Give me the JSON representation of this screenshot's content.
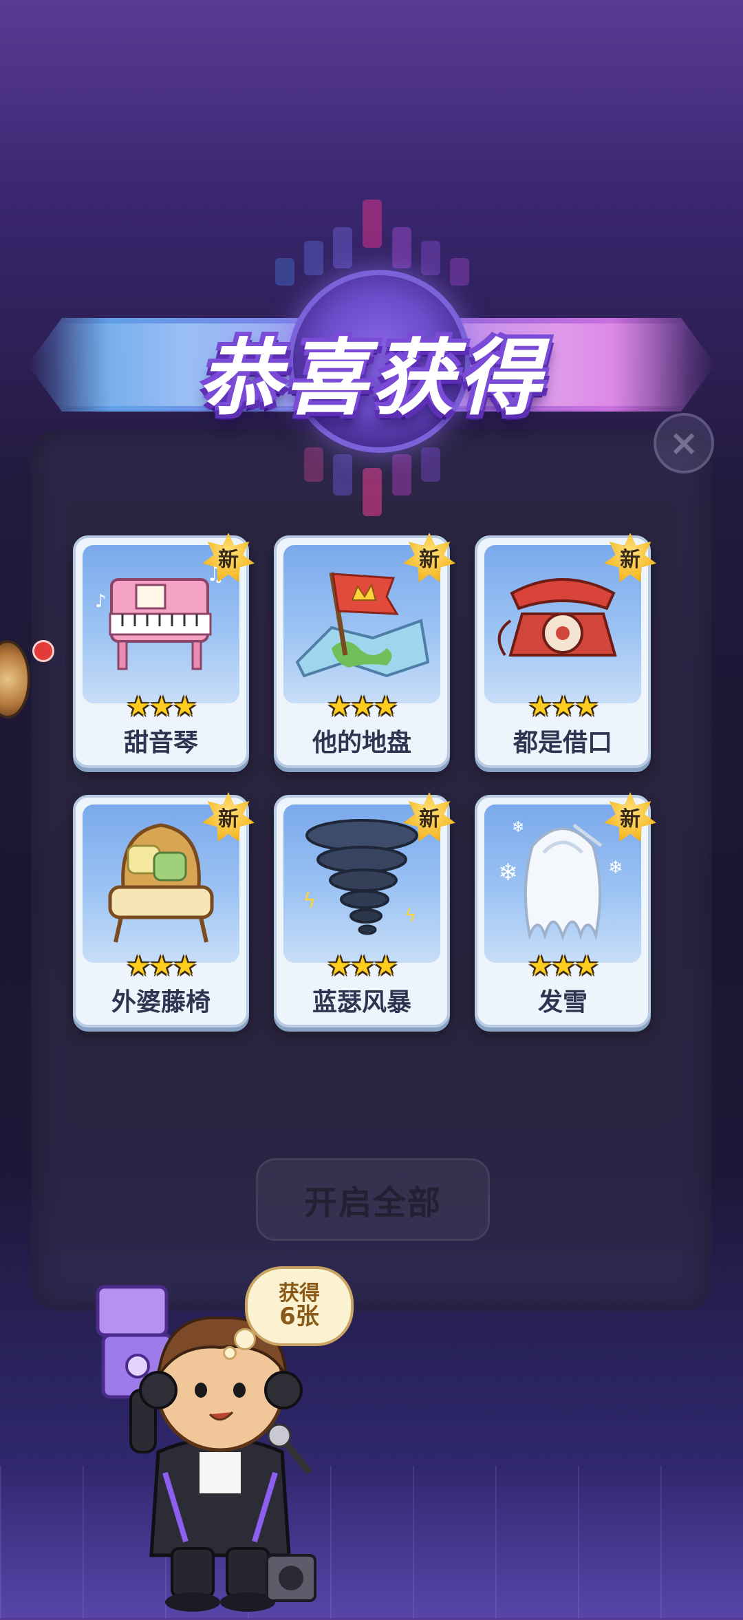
{
  "title": "恭喜获得",
  "rewards": [
    {
      "name": "甜音琴",
      "stars": "★★★",
      "badge": "新",
      "icon": "pink-piano"
    },
    {
      "name": "他的地盘",
      "stars": "★★★",
      "badge": "新",
      "icon": "crown-flag-map"
    },
    {
      "name": "都是借口",
      "stars": "★★★",
      "badge": "新",
      "icon": "red-rotary-telephone"
    },
    {
      "name": "外婆藤椅",
      "stars": "★★★",
      "badge": "新",
      "icon": "rattan-chair"
    },
    {
      "name": "蓝瑟风暴",
      "stars": "★★★",
      "badge": "新",
      "icon": "tornado"
    },
    {
      "name": "发雪",
      "stars": "★★★",
      "badge": "新",
      "icon": "white-snow-hair"
    }
  ],
  "open_all_label": "开启全部",
  "close_label": "×",
  "bubble": {
    "line1": "获得",
    "line2": "6张"
  },
  "colors": {
    "star": "#ffcd1f",
    "badge": "#f5b723",
    "card_bg": "#eef4fb"
  }
}
